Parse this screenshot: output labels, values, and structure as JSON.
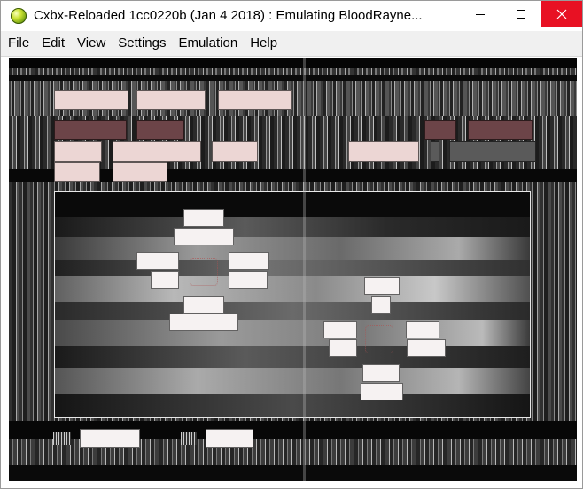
{
  "window": {
    "title": "Cxbx-Reloaded 1cc0220b (Jan  4 2018) : Emulating BloodRayne...",
    "icon": "cxbx-reloaded-icon",
    "controls": {
      "minimize": "minimize-icon",
      "maximize": "maximize-icon",
      "close": "close-icon"
    }
  },
  "menu": {
    "items": [
      "File",
      "Edit",
      "View",
      "Settings",
      "Emulation",
      "Help"
    ]
  },
  "viewport": {
    "description_colors": {
      "background": "#1a1a1a",
      "block_light": "#ecd6d4",
      "block_dark": "#6c4448",
      "block_gray": "#5a5a5a"
    }
  }
}
